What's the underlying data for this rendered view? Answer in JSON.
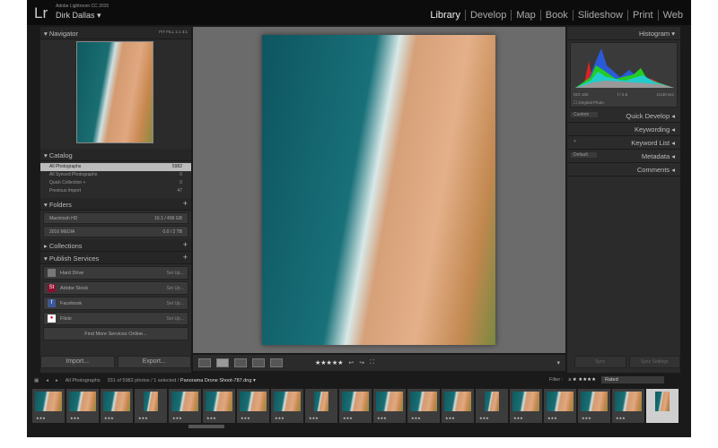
{
  "app": {
    "logo": "Lr",
    "product": "Adobe Lightroom CC 2015",
    "user": "Dirk Dallas ▾"
  },
  "modules": [
    "Library",
    "Develop",
    "Map",
    "Book",
    "Slideshow",
    "Print",
    "Web"
  ],
  "navigator": {
    "title": "▾ Navigator",
    "zoom": "FIT  FILL  1:1  3:1"
  },
  "catalog": {
    "title": "▾ Catalog",
    "items": [
      {
        "label": "All Photographs",
        "count": "5982"
      },
      {
        "label": "All Synced Photographs",
        "count": "0"
      },
      {
        "label": "Quick Collection +",
        "count": "0"
      },
      {
        "label": "Previous Import",
        "count": "47"
      }
    ]
  },
  "folders": {
    "title": "▾ Folders",
    "items": [
      {
        "label": "Macintosh HD",
        "size": "16.1 / 499 GB"
      },
      {
        "label": "2016 MEDIA",
        "size": "0.0 / 2 TB"
      }
    ]
  },
  "collections": {
    "title": "▸ Collections"
  },
  "publish": {
    "title": "▾ Publish Services",
    "items": [
      {
        "label": "Hard Drive",
        "action": "Set Up..."
      },
      {
        "label": "Adobe Stock",
        "action": "Set Up..."
      },
      {
        "label": "Facebook",
        "action": "Set Up..."
      },
      {
        "label": "Flickr",
        "action": "Set Up..."
      }
    ],
    "find_more": "Find More Services Online..."
  },
  "buttons": {
    "import": "Import...",
    "export": "Export..."
  },
  "histogram": {
    "title": "Histogram ▾",
    "iso": "ISO 100",
    "f": "f / 2.8",
    "shutter": "1/140 sec",
    "original": "☐ Original Photo"
  },
  "right_panels": [
    {
      "title": "Quick Develop ◂",
      "preset": "Custom"
    },
    {
      "title": "Keywording ◂"
    },
    {
      "title": "Keyword List ◂",
      "preset": "+"
    },
    {
      "title": "Metadata ◂",
      "preset": "Default"
    },
    {
      "title": "Comments ◂"
    }
  ],
  "toolbar": {
    "rating": "★★★★★"
  },
  "sync": {
    "sync": "Sync",
    "sync_settings": "Sync Settings"
  },
  "filmstrip": {
    "source": "All Photographs",
    "status": "331 of 5982 photos / 1 selected /",
    "filename": "Panorama Drone Shoot-787.dng ▾",
    "filter_label": "Filter :",
    "filter_stars": "≥ ★ ★★★★",
    "filter_value": "Rated",
    "thumb_stars": "★★★",
    "count": 19
  }
}
